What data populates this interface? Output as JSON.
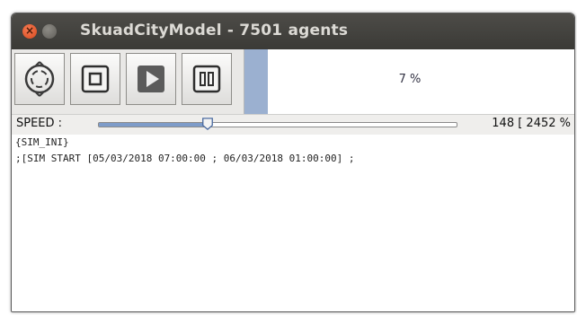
{
  "window": {
    "title": "SkuadCityModel - 7501 agents"
  },
  "toolbar": {
    "buttons": [
      {
        "name": "reset-icon"
      },
      {
        "name": "stop-icon"
      },
      {
        "name": "play-icon"
      },
      {
        "name": "pause-icon"
      }
    ],
    "progress": {
      "fraction": 0.07,
      "label": "7 %"
    }
  },
  "speed": {
    "label": "SPEED :",
    "value_text": "148 [ 2452 %",
    "slider_fraction": 0.305
  },
  "console": {
    "lines": [
      "{SIM_INI}",
      " ;[SIM START  [05/03/2018 07:00:00 ; 06/03/2018 01:00:00] ;"
    ]
  },
  "colors": {
    "titlebar": "#3b3a36",
    "close": "#e25a2c",
    "progress_fill": "#9bb0d0",
    "slider_fill": "#7e9cc9"
  }
}
